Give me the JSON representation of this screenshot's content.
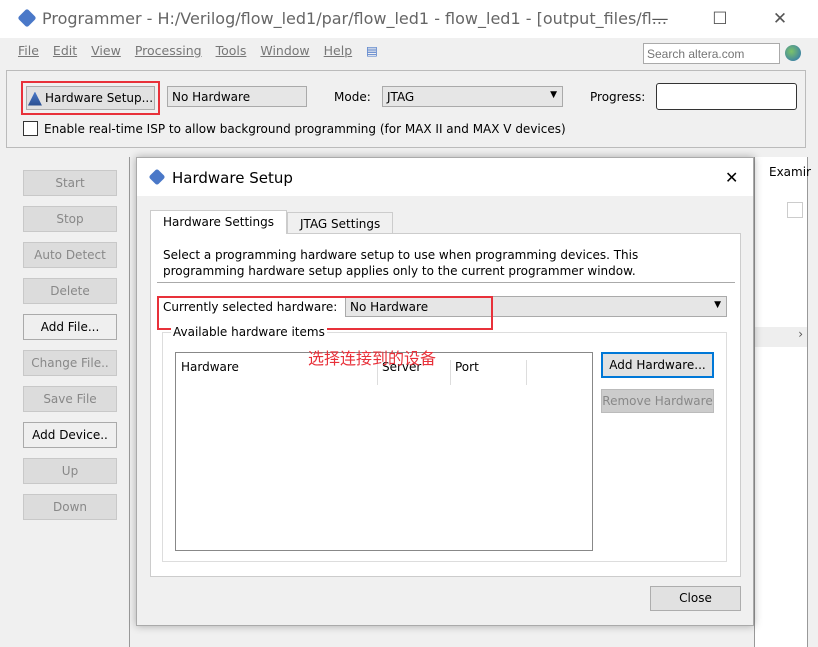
{
  "window": {
    "title": "Programmer - H:/Verilog/flow_led1/par/flow_led1 - flow_led1 - [output_files/fl...",
    "minimize": "—",
    "maximize": "☐",
    "close": "✕"
  },
  "menu": [
    "File",
    "Edit",
    "View",
    "Processing",
    "Tools",
    "Window",
    "Help"
  ],
  "search": {
    "placeholder": "Search altera.com"
  },
  "toolbar": {
    "hardware_setup": "Hardware Setup...",
    "hardware_value": "No Hardware",
    "mode_label": "Mode:",
    "mode_value": "JTAG",
    "progress_label": "Progress:",
    "isp_label": "Enable real-time ISP to allow background programming (for MAX II and MAX V devices)"
  },
  "left_buttons": [
    {
      "label": "Start",
      "enabled": false
    },
    {
      "label": "Stop",
      "enabled": false
    },
    {
      "label": "Auto Detect",
      "enabled": false
    },
    {
      "label": "Delete",
      "enabled": false
    },
    {
      "label": "Add File...",
      "enabled": true
    },
    {
      "label": "Change File..",
      "enabled": false
    },
    {
      "label": "Save File",
      "enabled": false
    },
    {
      "label": "Add Device..",
      "enabled": true
    },
    {
      "label": "Up",
      "enabled": false
    },
    {
      "label": "Down",
      "enabled": false
    }
  ],
  "right_partial": {
    "header": "Examir"
  },
  "dialog": {
    "title": "Hardware Setup",
    "close": "✕",
    "tabs": [
      "Hardware Settings",
      "JTAG Settings"
    ],
    "description": "Select a programming hardware setup to use when programming devices. This programming hardware setup applies only to the current programmer window.",
    "current_label": "Currently selected hardware:",
    "current_value": "No Hardware",
    "group_label": "Available hardware items",
    "columns": [
      "Hardware",
      "Server",
      "Port"
    ],
    "add_hardware": "Add Hardware...",
    "remove_hardware": "Remove Hardware",
    "close_button": "Close"
  },
  "annotation": {
    "text": "选择连接到的设备",
    "color": "#e8313a"
  }
}
